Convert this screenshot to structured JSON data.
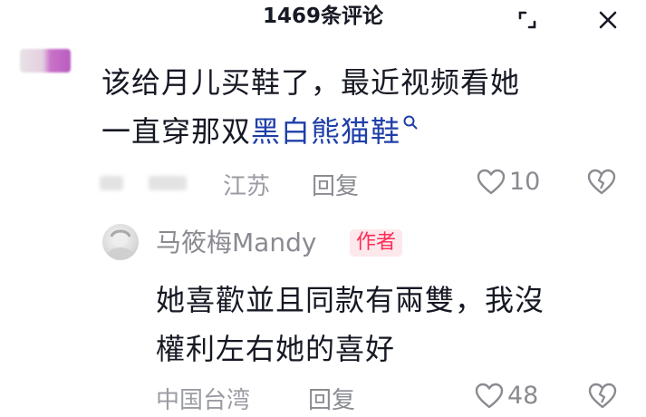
{
  "header": {
    "title": "1469条评论",
    "expand_icon": "expand-icon",
    "close_icon": "close-icon"
  },
  "comment": {
    "text_line1": "该给月儿买鞋了，最近视频看她",
    "text_line2_prefix": "一直穿那双",
    "topic_link": "黑白熊猫鞋",
    "location": "江苏",
    "reply_label": "回复",
    "like_count": "10"
  },
  "reply": {
    "author": "马筱梅Mandy",
    "badge": "作者",
    "text_line1": "她喜歡並且同款有兩雙，我沒",
    "text_line2": "權利左右她的喜好",
    "location": "中国台湾",
    "reply_label": "回复",
    "like_count": "48"
  },
  "colors": {
    "text": "#161823",
    "muted": "#8a8b91",
    "link": "#1f3fa8",
    "badge_bg": "#fde8ec",
    "badge_text": "#fe2c55"
  }
}
